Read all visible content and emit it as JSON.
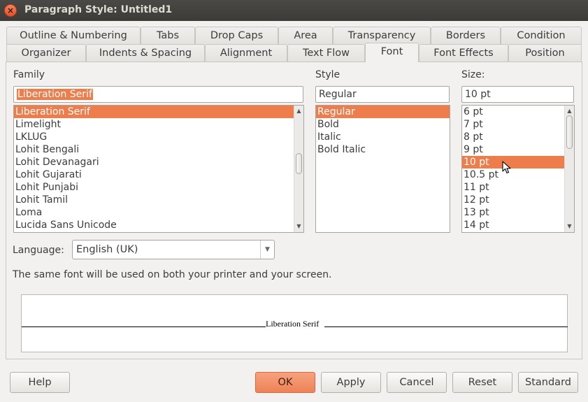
{
  "window": {
    "title": "Paragraph Style: Untitled1"
  },
  "tabs_row1": [
    "Outline & Numbering",
    "Tabs",
    "Drop Caps",
    "Area",
    "Transparency",
    "Borders",
    "Condition"
  ],
  "tabs_row2": [
    "Organizer",
    "Indents & Spacing",
    "Alignment",
    "Text Flow",
    "Font",
    "Font Effects",
    "Position"
  ],
  "active_tab": "Font",
  "family": {
    "label": "Family",
    "value": "Liberation Serif",
    "items": [
      "Liberation Serif",
      "Limelight",
      "LKLUG",
      "Lohit Bengali",
      "Lohit Devanagari",
      "Lohit Gujarati",
      "Lohit Punjabi",
      "Lohit Tamil",
      "Loma",
      "Lucida Sans Unicode"
    ],
    "selected": "Liberation Serif"
  },
  "style": {
    "label": "Style",
    "value": "Regular",
    "items": [
      "Regular",
      "Bold",
      "Italic",
      "Bold Italic"
    ],
    "selected": "Regular"
  },
  "size": {
    "label": "Size:",
    "value": "10 pt",
    "items": [
      "6 pt",
      "7 pt",
      "8 pt",
      "9 pt",
      "10 pt",
      "10.5 pt",
      "11 pt",
      "12 pt",
      "13 pt",
      "14 pt"
    ],
    "selected": "10 pt"
  },
  "language": {
    "label": "Language:",
    "value": "English (UK)"
  },
  "info_text": "The same font will be used on both your printer and your screen.",
  "preview_text": "Liberation Serif",
  "buttons": {
    "help": "Help",
    "ok": "OK",
    "apply": "Apply",
    "cancel": "Cancel",
    "reset": "Reset",
    "standard": "Standard"
  },
  "colors": {
    "accent": "#ef7d4c",
    "titlebar": "#3c3b37"
  }
}
